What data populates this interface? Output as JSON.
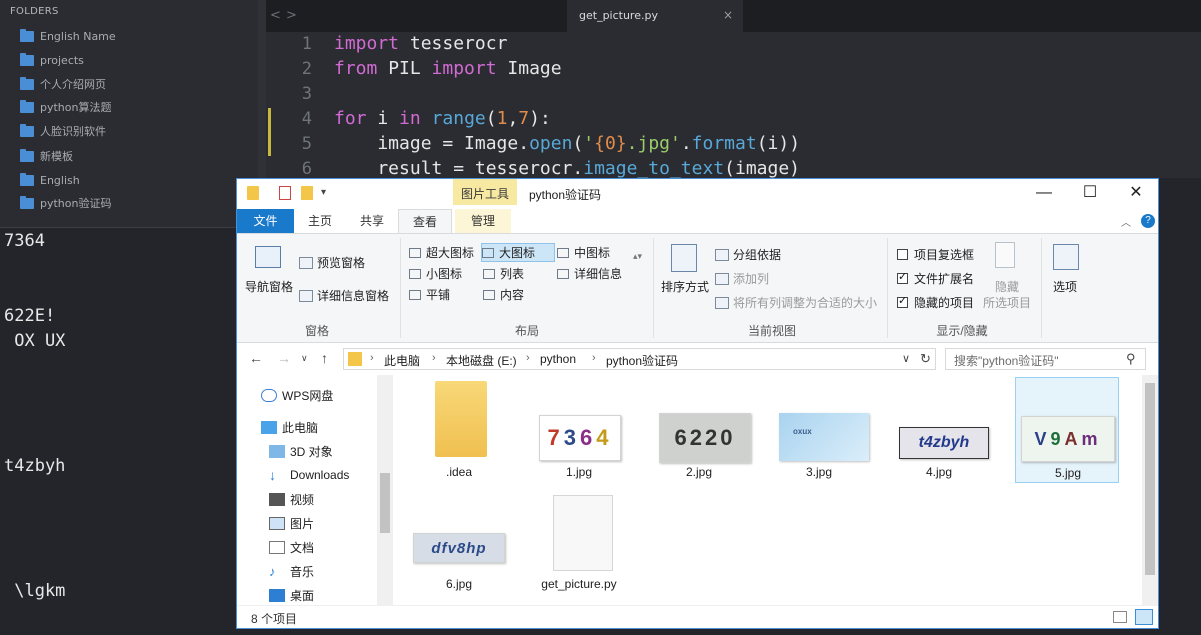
{
  "sidebar": {
    "header": "FOLDERS",
    "folders": [
      "English Name",
      "projects",
      "个人介绍网页",
      "python算法题",
      "人脸识别软件",
      "新模板",
      "English",
      "python验证码"
    ]
  },
  "editor": {
    "tab_title": "get_picture.py",
    "tab_close": "×",
    "nav_back": "<",
    "nav_forward": ">",
    "line_numbers": [
      "1",
      "2",
      "3",
      "4",
      "5",
      "6"
    ],
    "lines": {
      "l1_kw": "import",
      "l1_rest": " tesserocr",
      "l2_kw1": "from",
      "l2_mid": " PIL ",
      "l2_kw2": "import",
      "l2_rest": " Image",
      "l4_kw1": "for",
      "l4_a": " i ",
      "l4_kw2": "in",
      "l4_sp": " ",
      "l4_fn": "range",
      "l4_p1": "(",
      "l4_n1": "1",
      "l4_c": ",",
      "l4_n2": "7",
      "l4_p2": "):",
      "l5_a": "    image = Image.",
      "l5_m": "open",
      "l5_p": "(",
      "l5_s1": "'",
      "l5_br": "{0}",
      "l5_s2": ".jpg'",
      "l5_dot": ".",
      "l5_m2": "format",
      "l5_end": "(i))",
      "l6_a": "    result = tesserocr.",
      "l6_m": "image_to_text",
      "l6_end": "(image)"
    }
  },
  "console": {
    "lines": [
      "7364",
      "622E!",
      " OX UX",
      "t4zbyh",
      " \\lgkm"
    ]
  },
  "explorer": {
    "title": "python验证码",
    "picture_tools": "图片工具",
    "window_buttons": {
      "minimize": "—",
      "maximize": "☐",
      "close": "✕"
    },
    "tabs": {
      "file": "文件",
      "home": "主页",
      "share": "共享",
      "view": "查看",
      "manage": "管理"
    },
    "ribbon": {
      "panes": {
        "nav_pane": "导航窗格",
        "preview": "预览窗格",
        "details": "详细信息窗格",
        "group": "窗格"
      },
      "layout": {
        "xl_icons": "超大图标",
        "large_icons": "大图标",
        "medium_icons": "中图标",
        "small_icons": "小图标",
        "list": "列表",
        "details": "详细信息",
        "tiles": "平铺",
        "content": "内容",
        "group": "布局"
      },
      "current_view": {
        "sort": "排序方式",
        "group_by": "分组依据",
        "add_col": "添加列",
        "fit_cols": "将所有列调整为合适的大小",
        "group": "当前视图"
      },
      "show_hide": {
        "item_cb": "项目复选框",
        "ext": "文件扩展名",
        "hidden": "隐藏的项目",
        "hide": "隐藏",
        "hide_sel": "所选项目",
        "group": "显示/隐藏"
      },
      "options": "选项",
      "checkboxes": {
        "item_cb": false,
        "ext": true,
        "hidden": true
      }
    },
    "address": {
      "crumbs": [
        "此电脑",
        "本地磁盘 (E:)",
        "python",
        "python验证码"
      ],
      "search_placeholder": "搜索\"python验证码\""
    },
    "nav_items": [
      "WPS网盘",
      "此电脑",
      "3D 对象",
      "Downloads",
      "视频",
      "图片",
      "文档",
      "音乐",
      "桌面"
    ],
    "files": [
      {
        "name": ".idea",
        "kind": "folder"
      },
      {
        "name": "1.jpg",
        "kind": "image",
        "caption": "7364"
      },
      {
        "name": "2.jpg",
        "kind": "image",
        "caption": "6220"
      },
      {
        "name": "3.jpg",
        "kind": "image",
        "caption": "oxux"
      },
      {
        "name": "4.jpg",
        "kind": "image",
        "caption": "t4zbyh"
      },
      {
        "name": "5.jpg",
        "kind": "image",
        "caption": "V9Am"
      },
      {
        "name": "6.jpg",
        "kind": "image",
        "caption": "dfv8hp"
      },
      {
        "name": "get_picture.py",
        "kind": "document"
      }
    ],
    "status": "8 个项目"
  },
  "colors": {
    "accent": "#1979ca",
    "editor_bg": "#2a2c31",
    "keyword": "#d16ad3",
    "function": "#58a8d8",
    "number": "#e18c4c",
    "string": "#9ccc6a"
  }
}
